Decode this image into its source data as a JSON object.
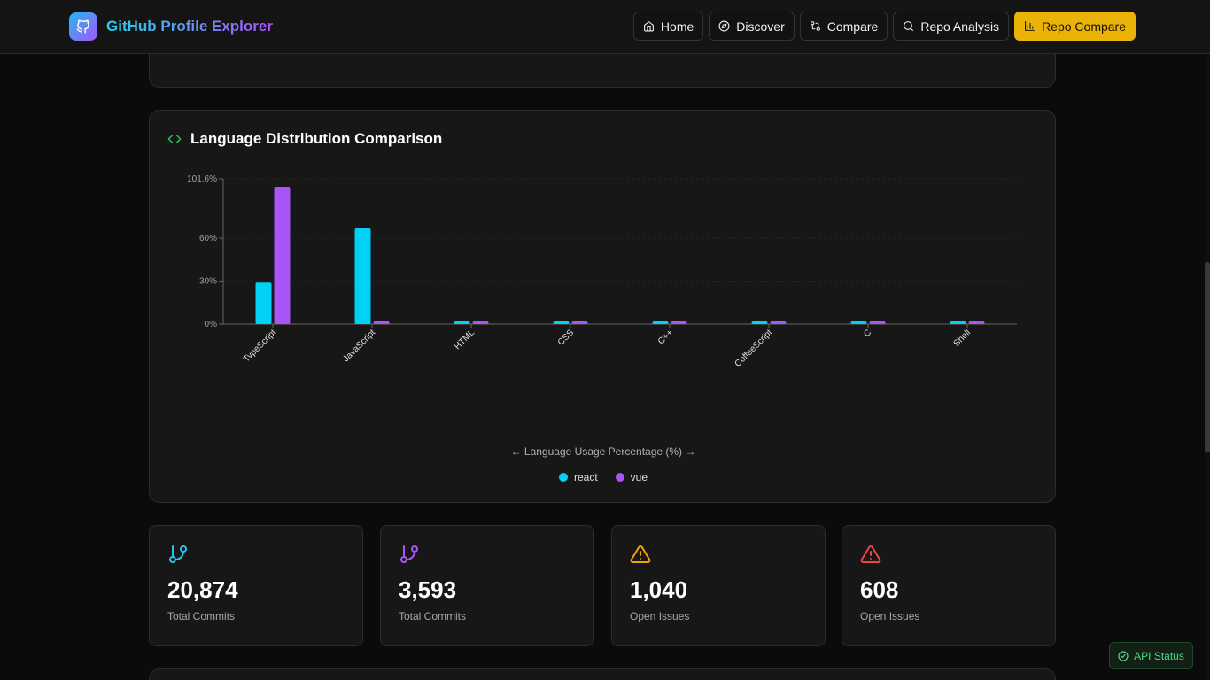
{
  "header": {
    "brand_title": "GitHub Profile Explorer",
    "nav": [
      {
        "label": "Home",
        "icon": "home-icon"
      },
      {
        "label": "Discover",
        "icon": "compass-icon"
      },
      {
        "label": "Compare",
        "icon": "git-compare-icon"
      },
      {
        "label": "Repo Analysis",
        "icon": "search-icon"
      },
      {
        "label": "Repo Compare",
        "icon": "bar-chart-icon",
        "active": true
      }
    ]
  },
  "language_card": {
    "title": "Language Distribution Comparison",
    "axis_caption": "← Language Usage Percentage (%) →",
    "legend": [
      {
        "name": "react",
        "color": "#00d1f5"
      },
      {
        "name": "vue",
        "color": "#a855f7"
      }
    ]
  },
  "chart_data": {
    "type": "bar",
    "categories": [
      "TypeScript",
      "JavaScript",
      "HTML",
      "CSS",
      "C++",
      "CoffeeScript",
      "C",
      "Shell"
    ],
    "series": [
      {
        "name": "react",
        "color": "#00d1f5",
        "values": [
          29,
          67,
          0,
          0,
          0,
          0,
          0,
          0
        ]
      },
      {
        "name": "vue",
        "color": "#a855f7",
        "values": [
          96,
          0,
          0,
          0,
          0,
          0,
          0,
          0
        ]
      }
    ],
    "ylim": [
      0,
      101.6
    ],
    "yticks": [
      "0%",
      "30%",
      "60%",
      "101.6%"
    ],
    "ytick_values": [
      0,
      30,
      60,
      101.6
    ],
    "grid": true,
    "legend_position": "bottom-center"
  },
  "stats": [
    {
      "value": "20,874",
      "label": "Total Commits",
      "icon": "git-branch-icon",
      "color": "#22c5f0"
    },
    {
      "value": "3,593",
      "label": "Total Commits",
      "icon": "git-branch-icon",
      "color": "#a855f7"
    },
    {
      "value": "1,040",
      "label": "Open Issues",
      "icon": "alert-triangle-icon",
      "color": "#f59e0b"
    },
    {
      "value": "608",
      "label": "Open Issues",
      "icon": "alert-triangle-icon",
      "color": "#ef4444"
    }
  ],
  "api_status": {
    "label": "API Status",
    "icon": "check-circle-icon"
  }
}
